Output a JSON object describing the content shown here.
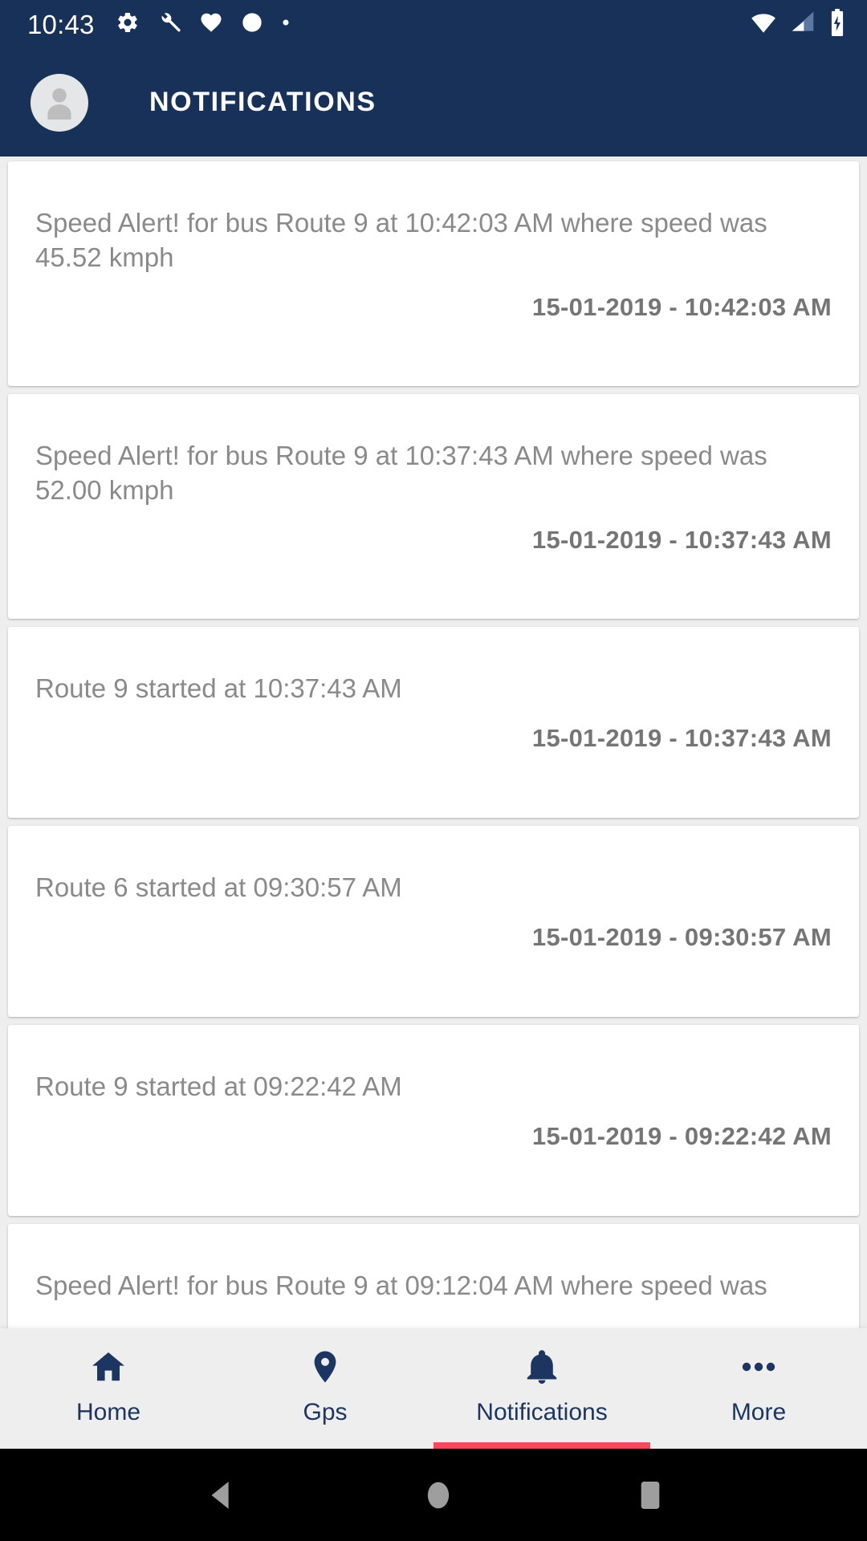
{
  "status_bar": {
    "clock": "10:43",
    "left_icons": [
      "gear-icon",
      "wrench-icon",
      "heart-icon",
      "circle-icon",
      "dot-icon"
    ],
    "right_icons": [
      "wifi-icon",
      "cellular-signal-icon",
      "battery-charging-icon"
    ]
  },
  "app_bar": {
    "title": "NOTIFICATIONS",
    "avatar": "user-avatar-icon",
    "background_color": "#173158"
  },
  "notifications": [
    {
      "message": "Speed Alert! for bus Route 9 at 10:42:03 AM where speed was 45.52 kmph",
      "timestamp": "15-01-2019 - 10:42:03 AM"
    },
    {
      "message": "Speed Alert! for bus Route 9 at 10:37:43 AM where speed was 52.00 kmph",
      "timestamp": "15-01-2019 - 10:37:43 AM"
    },
    {
      "message": "Route 9 started at 10:37:43 AM",
      "timestamp": "15-01-2019 - 10:37:43 AM"
    },
    {
      "message": "Route 6 started at 09:30:57 AM",
      "timestamp": "15-01-2019 - 09:30:57 AM"
    },
    {
      "message": "Route 9 started at 09:22:42 AM",
      "timestamp": "15-01-2019 - 09:22:42 AM"
    },
    {
      "message": "Speed Alert! for bus Route 9 at 09:12:04 AM where speed was",
      "timestamp": ""
    }
  ],
  "bottom_nav": {
    "active_index": 2,
    "indicator_color": "#f8485e",
    "items": [
      {
        "label": "Home",
        "icon": "home-icon"
      },
      {
        "label": "Gps",
        "icon": "location-pin-icon"
      },
      {
        "label": "Notifications",
        "icon": "bell-icon"
      },
      {
        "label": "More",
        "icon": "more-dots-icon"
      }
    ]
  },
  "android_nav": {
    "buttons": [
      {
        "name": "back-button",
        "icon": "triangle-left-icon"
      },
      {
        "name": "home-button",
        "icon": "circle-icon"
      },
      {
        "name": "recents-button",
        "icon": "square-icon"
      }
    ]
  },
  "colors": {
    "primary": "#173158",
    "accent": "#f8485e",
    "page_background": "#eeeeee",
    "card_background": "#ffffff",
    "message_text": "#8a8a8a",
    "timestamp_text": "#757575",
    "nav_text": "#1c3661"
  }
}
